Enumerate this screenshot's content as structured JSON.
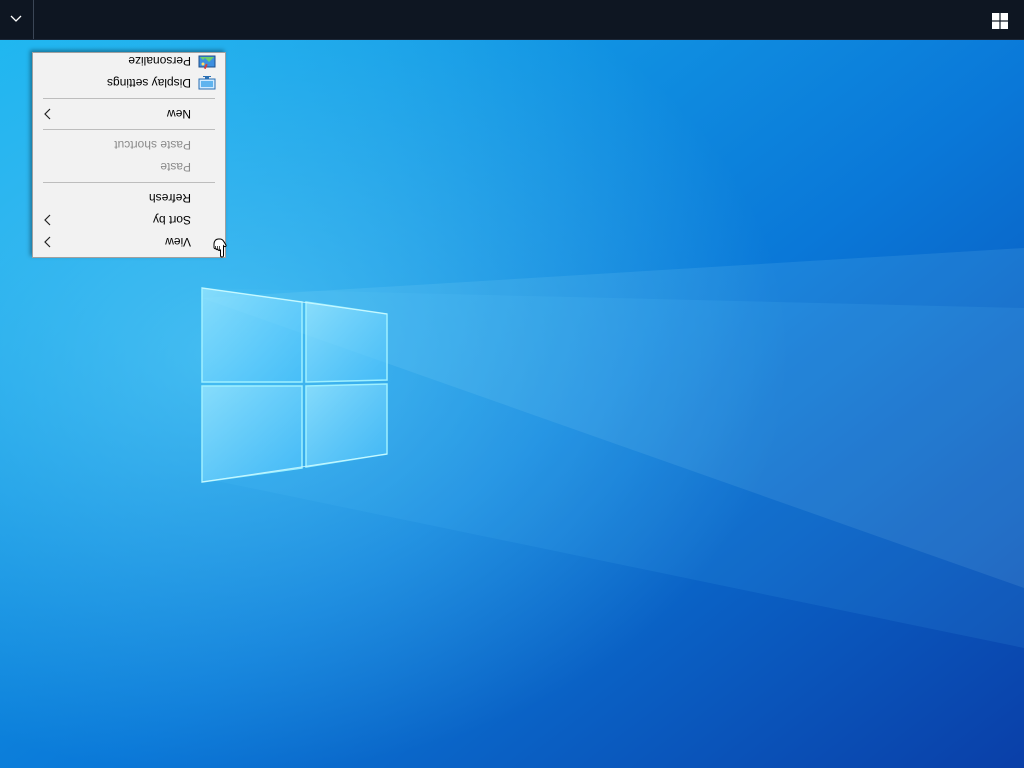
{
  "desktop": {
    "wallpaper": "windows-10-hero",
    "colors": {
      "wallpaper_light": "#19b6f0",
      "wallpaper_mid": "#0a78d8",
      "wallpaper_dark": "#0a3fa8",
      "taskbar": "#0e1622"
    }
  },
  "taskbar": {
    "start_icon": "windows-logo-icon",
    "tray_icon": "chevron-up-icon"
  },
  "context_menu": {
    "items": [
      {
        "label": "View",
        "submenu": true
      },
      {
        "label": "Sort by",
        "submenu": true
      },
      {
        "label": "Refresh"
      },
      {
        "label": "Paste",
        "disabled": true
      },
      {
        "label": "Paste shortcut",
        "disabled": true
      },
      {
        "label": "New",
        "submenu": true
      },
      {
        "label": "Display settings",
        "icon": "display-icon"
      },
      {
        "label": "Personalize",
        "icon": "personalize-icon"
      }
    ]
  }
}
